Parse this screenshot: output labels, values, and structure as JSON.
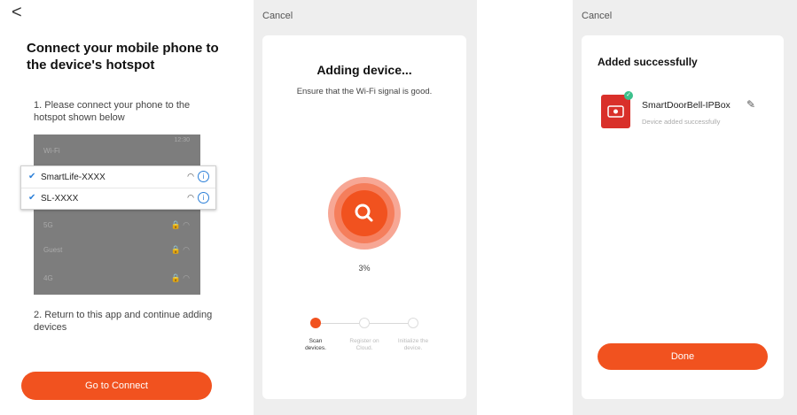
{
  "panel1": {
    "back_glyph": "<",
    "title": "Connect your mobile phone to the device's hotspot",
    "step1": "1. Please connect your phone to the hotspot shown below",
    "phone": {
      "header": "Wi-Fi",
      "status": "12:30",
      "popup": [
        {
          "name": "SmartLife-XXXX"
        },
        {
          "name": "SL-XXXX"
        }
      ],
      "networks": [
        "5G",
        "Guest",
        "4G"
      ]
    },
    "step2": "2. Return to this app and continue adding devices",
    "connect_button": "Go to Connect"
  },
  "panel2": {
    "cancel": "Cancel",
    "title": "Adding device...",
    "subtitle": "Ensure that the Wi-Fi signal is good.",
    "progress_text": "3%",
    "progress": 0.03,
    "steps": [
      {
        "label": "Scan devices.",
        "state": "active"
      },
      {
        "label": "Register on Cloud.",
        "state": "pending"
      },
      {
        "label": "Initialize the device.",
        "state": "pending"
      }
    ]
  },
  "panel3": {
    "cancel": "Cancel",
    "title": "Added successfully",
    "device_name": "SmartDoorBell-IPBox",
    "device_status": "Device added successfully",
    "done_button": "Done"
  },
  "colors": {
    "accent": "#f1521f",
    "check": "#2b7fd8",
    "success": "#3cc08c"
  }
}
